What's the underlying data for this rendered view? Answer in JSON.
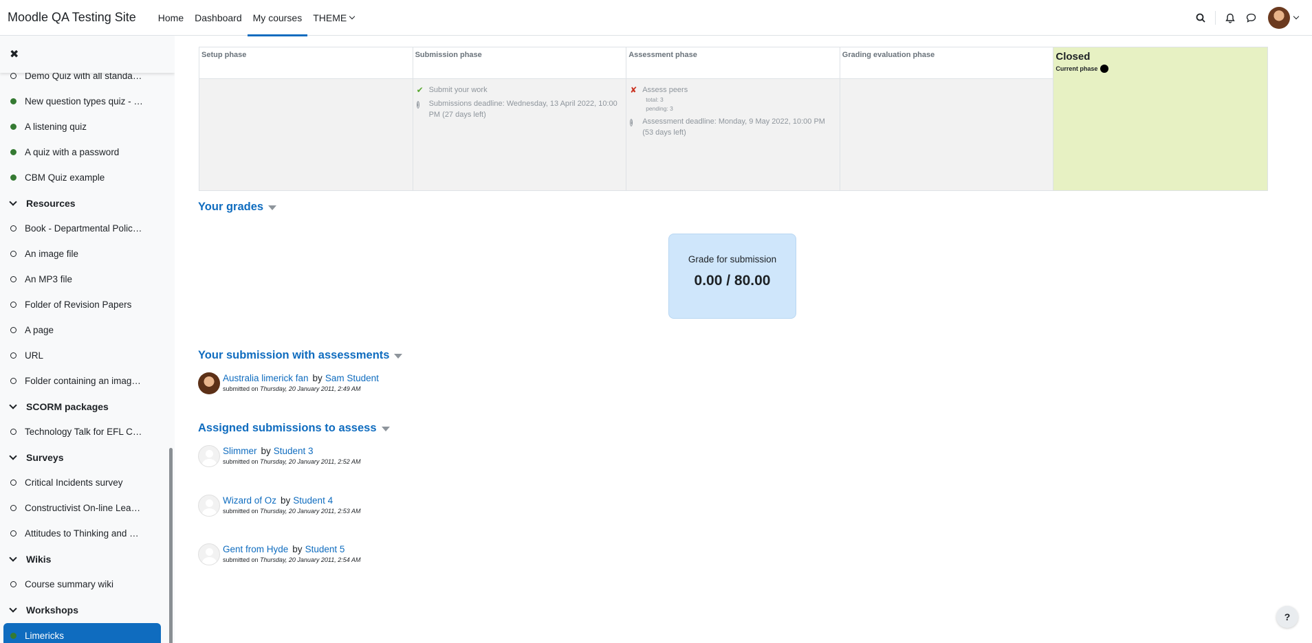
{
  "navbar": {
    "site_name": "Moodle QA Testing Site",
    "items": [
      {
        "label": "Home"
      },
      {
        "label": "Dashboard"
      },
      {
        "label": "My courses"
      },
      {
        "label": "THEME"
      }
    ],
    "icons": [
      "search-icon",
      "bell-icon",
      "chat-icon"
    ]
  },
  "drawer": {
    "rows": [
      {
        "type": "activity",
        "label": "Demo Quiz with all standa…",
        "done": false
      },
      {
        "type": "activity",
        "label": "New question types quiz - …",
        "done": true
      },
      {
        "type": "activity",
        "label": "A listening quiz",
        "done": true
      },
      {
        "type": "activity",
        "label": "A quiz with a password",
        "done": true
      },
      {
        "type": "activity",
        "label": "CBM Quiz example",
        "done": true
      },
      {
        "type": "section",
        "label": "Resources"
      },
      {
        "type": "activity",
        "label": "Book - Departmental Polic…",
        "done": false
      },
      {
        "type": "activity",
        "label": "An image file",
        "done": false
      },
      {
        "type": "activity",
        "label": "An MP3 file",
        "done": false
      },
      {
        "type": "activity",
        "label": "Folder of Revision Papers",
        "done": false
      },
      {
        "type": "activity",
        "label": "A page",
        "done": false
      },
      {
        "type": "activity",
        "label": "URL",
        "done": false
      },
      {
        "type": "activity",
        "label": "Folder containing an imag…",
        "done": false
      },
      {
        "type": "section",
        "label": "SCORM packages"
      },
      {
        "type": "activity",
        "label": "Technology Talk for EFL C…",
        "done": false
      },
      {
        "type": "section",
        "label": "Surveys"
      },
      {
        "type": "activity",
        "label": "Critical Incidents survey",
        "done": false
      },
      {
        "type": "activity",
        "label": "Constructivist On-line Lear…",
        "done": false
      },
      {
        "type": "activity",
        "label": "Attitudes to Thinking and …",
        "done": false
      },
      {
        "type": "section",
        "label": "Wikis"
      },
      {
        "type": "activity",
        "label": "Course summary wiki",
        "done": false
      },
      {
        "type": "section",
        "label": "Workshops"
      },
      {
        "type": "activity",
        "label": "Limericks",
        "done": true,
        "selected": true
      }
    ]
  },
  "phases": {
    "setup": {
      "title": "Setup phase"
    },
    "submission": {
      "title": "Submission phase",
      "task": "Submit your work",
      "deadline": "Submissions deadline: Wednesday, 13 April 2022, 10:00 PM (27 days left)"
    },
    "assessment": {
      "title": "Assessment phase",
      "task": "Assess peers",
      "total": "total: 3",
      "pending": "pending: 3",
      "deadline": "Assessment deadline: Monday, 9 May 2022, 10:00 PM (53 days left)"
    },
    "grading": {
      "title": "Grading evaluation phase"
    },
    "closed": {
      "title": "Closed",
      "current_label": "Current phase"
    }
  },
  "grades": {
    "title": "Your grades",
    "label": "Grade for submission",
    "value": "0.00 / 80.00"
  },
  "your_submission": {
    "title": "Your submission with assessments",
    "item": {
      "title": "Australia limerick fan",
      "by": "by",
      "author": "Sam Student",
      "submitted_label": "submitted on",
      "date": "Thursday, 20 January 2011, 2:49 AM"
    }
  },
  "assigned": {
    "title": "Assigned submissions to assess",
    "items": [
      {
        "title": "Slimmer",
        "by": "by",
        "author": "Student 3",
        "submitted_label": "submitted on",
        "date": "Thursday, 20 January 2011, 2:52 AM"
      },
      {
        "title": "Wizard of Oz",
        "by": "by",
        "author": "Student 4",
        "submitted_label": "submitted on",
        "date": "Thursday, 20 January 2011, 2:53 AM"
      },
      {
        "title": "Gent from Hyde",
        "by": "by",
        "author": "Student 5",
        "submitted_label": "submitted on",
        "date": "Thursday, 20 January 2011, 2:54 AM"
      }
    ]
  },
  "help": {
    "label": "?"
  }
}
